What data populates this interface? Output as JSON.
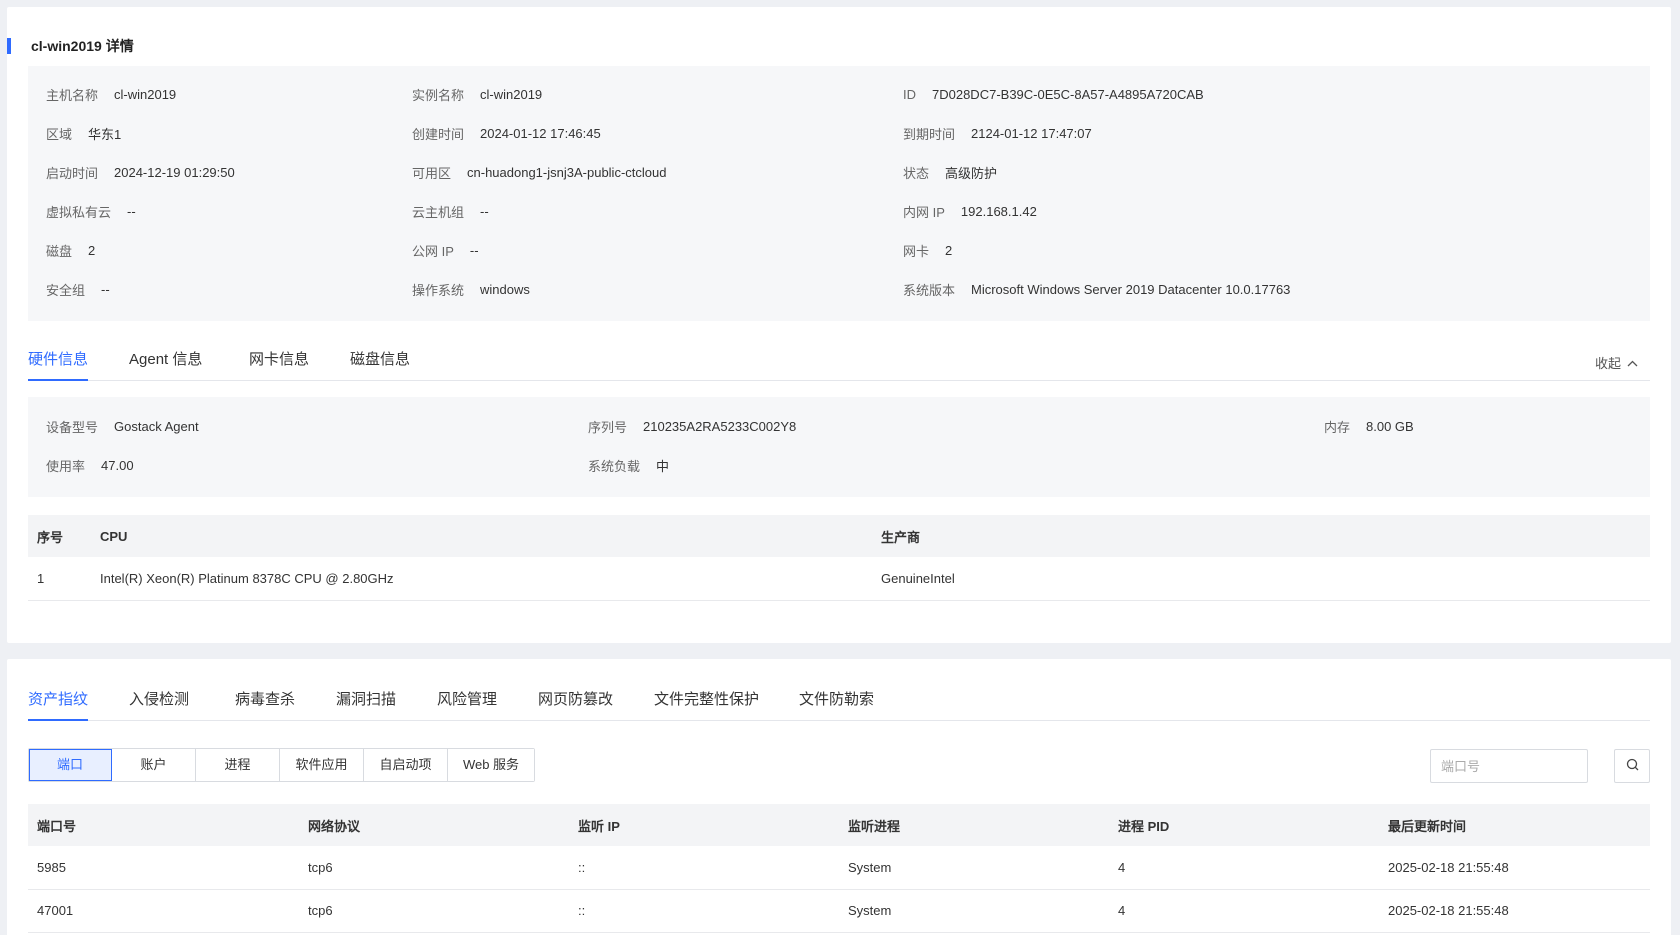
{
  "page_title": "cl-win2019 详情",
  "basic_info": {
    "host_name": {
      "label": "主机名称",
      "value": "cl-win2019"
    },
    "instance_name": {
      "label": "实例名称",
      "value": "cl-win2019"
    },
    "id": {
      "label": "ID",
      "value": "7D028DC7-B39C-0E5C-8A57-A4895A720CAB"
    },
    "region": {
      "label": "区域",
      "value": "华东1"
    },
    "created": {
      "label": "创建时间",
      "value": "2024-01-12 17:46:45"
    },
    "expires": {
      "label": "到期时间",
      "value": "2124-01-12 17:47:07"
    },
    "started": {
      "label": "启动时间",
      "value": "2024-12-19 01:29:50"
    },
    "zone": {
      "label": "可用区",
      "value": "cn-huadong1-jsnj3A-public-ctcloud"
    },
    "status": {
      "label": "状态",
      "value": "高级防护"
    },
    "vpc": {
      "label": "虚拟私有云",
      "value": "--"
    },
    "host_group": {
      "label": "云主机组",
      "value": "--"
    },
    "private_ip": {
      "label": "内网 IP",
      "value": "192.168.1.42"
    },
    "disks": {
      "label": "磁盘",
      "value": "2"
    },
    "public_ip": {
      "label": "公网 IP",
      "value": "--"
    },
    "nics": {
      "label": "网卡",
      "value": "2"
    },
    "security_group": {
      "label": "安全组",
      "value": "--"
    },
    "os": {
      "label": "操作系统",
      "value": "windows"
    },
    "os_version": {
      "label": "系统版本",
      "value": "Microsoft Windows Server 2019 Datacenter 10.0.17763"
    }
  },
  "detail_tabs": {
    "items": [
      "硬件信息",
      "Agent 信息",
      "网卡信息",
      "磁盘信息"
    ],
    "collapse_label": "收起"
  },
  "hardware": {
    "model": {
      "label": "设备型号",
      "value": "Gostack Agent"
    },
    "serial": {
      "label": "序列号",
      "value": "210235A2RA5233C002Y8"
    },
    "memory": {
      "label": "内存",
      "value": "8.00 GB"
    },
    "usage": {
      "label": "使用率",
      "value": "47.00"
    },
    "load": {
      "label": "系统负载",
      "value": "中"
    }
  },
  "cpu_table": {
    "headers": [
      "序号",
      "CPU",
      "生产商"
    ],
    "rows": [
      [
        "1",
        "Intel(R) Xeon(R) Platinum 8378C CPU @ 2.80GHz",
        "GenuineIntel"
      ]
    ]
  },
  "security_tabs": [
    "资产指纹",
    "入侵检测",
    "病毒查杀",
    "漏洞扫描",
    "风险管理",
    "网页防篡改",
    "文件完整性保护",
    "文件防勒索"
  ],
  "asset_segments": [
    "端口",
    "账户",
    "进程",
    "软件应用",
    "自启动项",
    "Web 服务"
  ],
  "search": {
    "placeholder": "端口号"
  },
  "port_table": {
    "headers": [
      "端口号",
      "网络协议",
      "监听 IP",
      "监听进程",
      "进程 PID",
      "最后更新时间"
    ],
    "rows": [
      [
        "5985",
        "tcp6",
        "::",
        "System",
        "4",
        "2025-02-18 21:55:48"
      ],
      [
        "47001",
        "tcp6",
        "::",
        "System",
        "4",
        "2025-02-18 21:55:48"
      ]
    ]
  },
  "colors": {
    "accent": "#2f6bff",
    "panel_bg": "#f6f7f9",
    "page_bg": "#eef0f4"
  }
}
